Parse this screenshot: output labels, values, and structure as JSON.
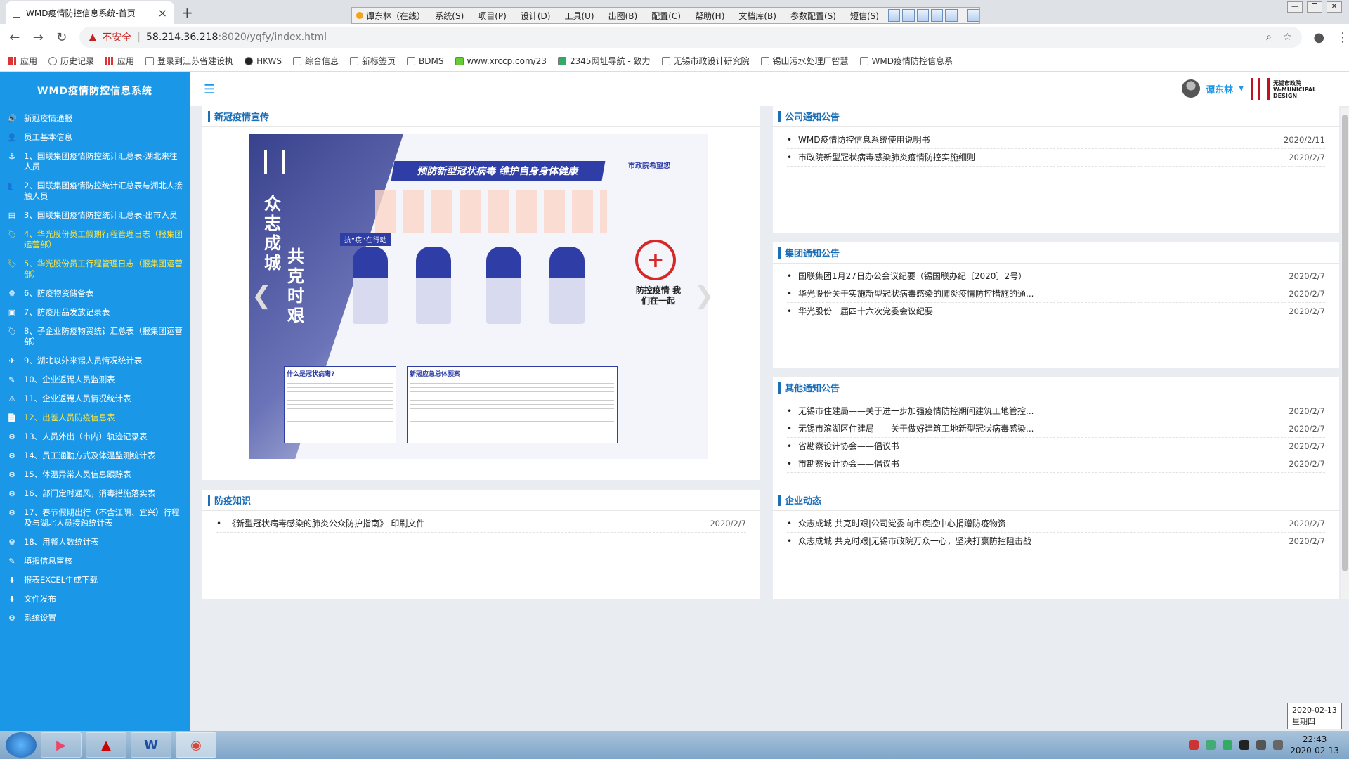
{
  "browser": {
    "tab_title": "WMD疫情防控信息系统-首页",
    "warning_label": "不安全",
    "url_host": "58.214.36.218",
    "url_rest": ":8020/yqfy/index.html",
    "bookmarks": [
      "应用",
      "历史记录",
      "应用",
      "登录到江苏省建设执",
      "HKWS",
      "综合信息",
      "新标签页",
      "BDMS",
      "www.xrccp.com/23",
      "2345网址导航 - 致力",
      "无锡市政设计研究院",
      "锡山污水处理厂智慧",
      "WMD疫情防控信息系"
    ]
  },
  "topmenu": {
    "user": "谭东林（在线）",
    "items": [
      "系统(S)",
      "项目(P)",
      "设计(D)",
      "工具(U)",
      "出图(B)",
      "配置(C)",
      "帮助(H)",
      "文档库(B)",
      "参数配置(S)",
      "短信(S)"
    ]
  },
  "sidebar": {
    "brand": "WMD疫情防控信息系统",
    "items": [
      {
        "label": "新冠疫情通报",
        "icon": "🔊"
      },
      {
        "label": "员工基本信息",
        "icon": "👤"
      },
      {
        "label": "1、国联集团疫情防控统计汇总表-湖北来往人员",
        "icon": "⚓"
      },
      {
        "label": "2、国联集团疫情防控统计汇总表与湖北人接触人员",
        "icon": "👥"
      },
      {
        "label": "3、国联集团疫情防控统计汇总表-出市人员",
        "icon": "▤"
      },
      {
        "label": "4、华光股份员工假期行程管理日志（报集团运营部）",
        "icon": "🏷"
      },
      {
        "label": "5、华光股份员工行程管理日志（报集团运营部）",
        "icon": "🏷"
      },
      {
        "label": "6、防疫物资储备表",
        "icon": "⚙"
      },
      {
        "label": "7、防疫用品发放记录表",
        "icon": "▣"
      },
      {
        "label": "8、子企业防疫物资统计汇总表（报集团运营部）",
        "icon": "🏷"
      },
      {
        "label": "9、湖北以外来锡人员情况统计表",
        "icon": "✈"
      },
      {
        "label": "10、企业返锡人员监测表",
        "icon": "✎"
      },
      {
        "label": "11、企业返锡人员情况统计表",
        "icon": "⚠"
      },
      {
        "label": "12、出差人员防疫信息表",
        "icon": "📄"
      },
      {
        "label": "13、人员外出（市内）轨迹记录表",
        "icon": "⚙"
      },
      {
        "label": "14、员工通勤方式及体温监测统计表",
        "icon": "⚙"
      },
      {
        "label": "15、体温异常人员信息跟踪表",
        "icon": "⚙"
      },
      {
        "label": "16、部门定时通风，消毒措施落实表",
        "icon": "⚙"
      },
      {
        "label": "17、春节假期出行（不含江阴、宜兴）行程及与湖北人员接触统计表",
        "icon": "⚙"
      },
      {
        "label": "18、用餐人数统计表",
        "icon": "⚙"
      },
      {
        "label": "填报信息审核",
        "icon": "✎"
      },
      {
        "label": "报表EXCEL生成下载",
        "icon": "⬇"
      },
      {
        "label": "文件发布",
        "icon": "⬇"
      },
      {
        "label": "系统设置",
        "icon": "⚙"
      }
    ]
  },
  "header": {
    "user_name": "谭东林",
    "logo_text_1": "无锡市政院",
    "logo_text_2": "W-MUNICIPAL",
    "logo_text_3": "DESIGN"
  },
  "panels": {
    "promo": {
      "title": "新冠疫情宣传"
    },
    "poster": {
      "vtitle_1": "众志成城",
      "vtitle_2": "共克时艰",
      "headline": "预防新型冠状病毒   维护自身身体健康",
      "hope": "市政院希望您",
      "tag": "抗“疫”在行动",
      "cross_text": "防控疫情 我们在一起",
      "box1_title": "什么是冠状病毒?",
      "box2_title": "新冠应急总体预案"
    },
    "company": {
      "title": "公司通知公告",
      "items": [
        {
          "text": "WMD疫情防控信息系统使用说明书",
          "date": "2020/2/11"
        },
        {
          "text": "市政院新型冠状病毒感染肺炎疫情防控实施细则",
          "date": "2020/2/7"
        }
      ]
    },
    "group": {
      "title": "集团通知公告",
      "items": [
        {
          "text": "国联集团1月27日办公会议纪要（锡国联办纪〔2020〕2号）",
          "date": "2020/2/7"
        },
        {
          "text": "华光股份关于实施新型冠状病毒感染的肺炎疫情防控措施的通...",
          "date": "2020/2/7"
        },
        {
          "text": "华光股份一届四十六次党委会议纪要",
          "date": "2020/2/7"
        }
      ]
    },
    "other": {
      "title": "其他通知公告",
      "items": [
        {
          "text": "无锡市住建局——关于进一步加强疫情防控期间建筑工地管控...",
          "date": "2020/2/7"
        },
        {
          "text": "无锡市滨湖区住建局——关于做好建筑工地新型冠状病毒感染...",
          "date": "2020/2/7"
        },
        {
          "text": "省勘察设计协会——倡议书",
          "date": "2020/2/7"
        },
        {
          "text": "市勘察设计协会——倡议书",
          "date": "2020/2/7"
        }
      ]
    },
    "knowledge": {
      "title": "防疫知识",
      "items": [
        {
          "text": "《新型冠状病毒感染的肺炎公众防护指南》-印刷文件",
          "date": "2020/2/7"
        }
      ]
    },
    "enterprise": {
      "title": "企业动态",
      "items": [
        {
          "text": "众志成城 共克时艰|公司党委向市疾控中心捐赠防疫物资",
          "date": "2020/2/7"
        },
        {
          "text": "众志成城 共克时艰|无锡市政院万众一心，坚决打赢防控阻击战",
          "date": "2020/2/7"
        }
      ]
    }
  },
  "tooltip": {
    "date": "2020-02-13",
    "weekday": "星期四"
  },
  "taskbar": {
    "time": "22:43",
    "date": "2020-02-13"
  }
}
